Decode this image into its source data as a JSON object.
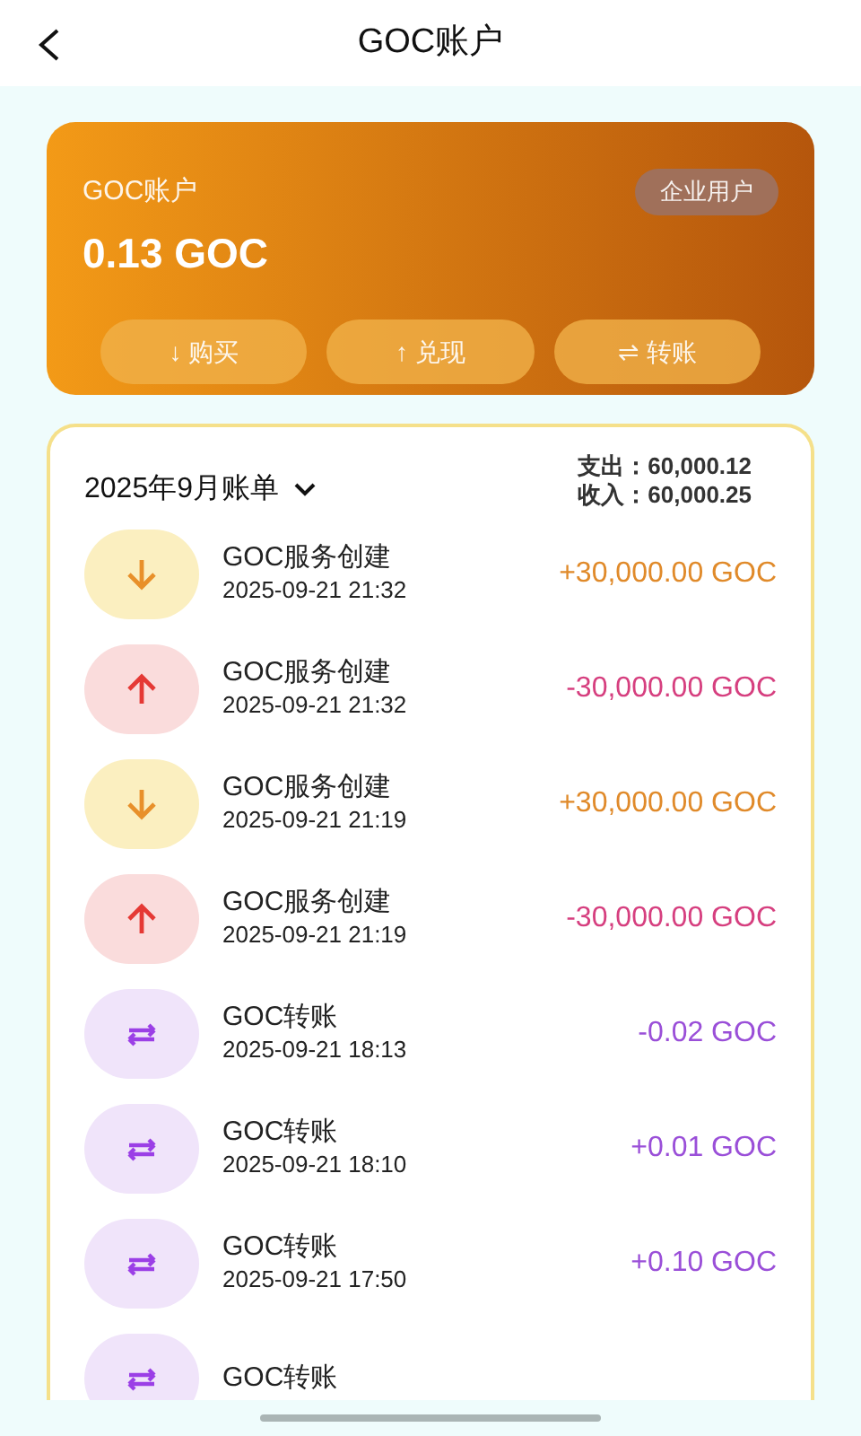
{
  "header": {
    "title": "GOC账户"
  },
  "account": {
    "label": "GOC账户",
    "badge": "企业用户",
    "balance": "0.13 GOC",
    "actions": [
      "↓ 购买",
      "↑ 兑现",
      "⇌ 转账"
    ]
  },
  "bill": {
    "period": "2025年9月账单",
    "expense": "支出：60,000.12",
    "income": "收入：60,000.25",
    "rows": [
      {
        "kind": "in",
        "title": "GOC服务创建",
        "time": "2025-09-21 21:32",
        "amount": "+30,000.00 GOC"
      },
      {
        "kind": "out",
        "title": "GOC服务创建",
        "time": "2025-09-21 21:32",
        "amount": "-30,000.00 GOC"
      },
      {
        "kind": "in",
        "title": "GOC服务创建",
        "time": "2025-09-21 21:19",
        "amount": "+30,000.00 GOC"
      },
      {
        "kind": "out",
        "title": "GOC服务创建",
        "time": "2025-09-21 21:19",
        "amount": "-30,000.00 GOC"
      },
      {
        "kind": "transfer",
        "title": "GOC转账",
        "time": "2025-09-21 18:13",
        "amount": "-0.02 GOC"
      },
      {
        "kind": "transfer",
        "title": "GOC转账",
        "time": "2025-09-21 18:10",
        "amount": "+0.01 GOC"
      },
      {
        "kind": "transfer",
        "title": "GOC转账",
        "time": "2025-09-21 17:50",
        "amount": "+0.10 GOC"
      },
      {
        "kind": "transfer",
        "title": "GOC转账"
      }
    ]
  }
}
